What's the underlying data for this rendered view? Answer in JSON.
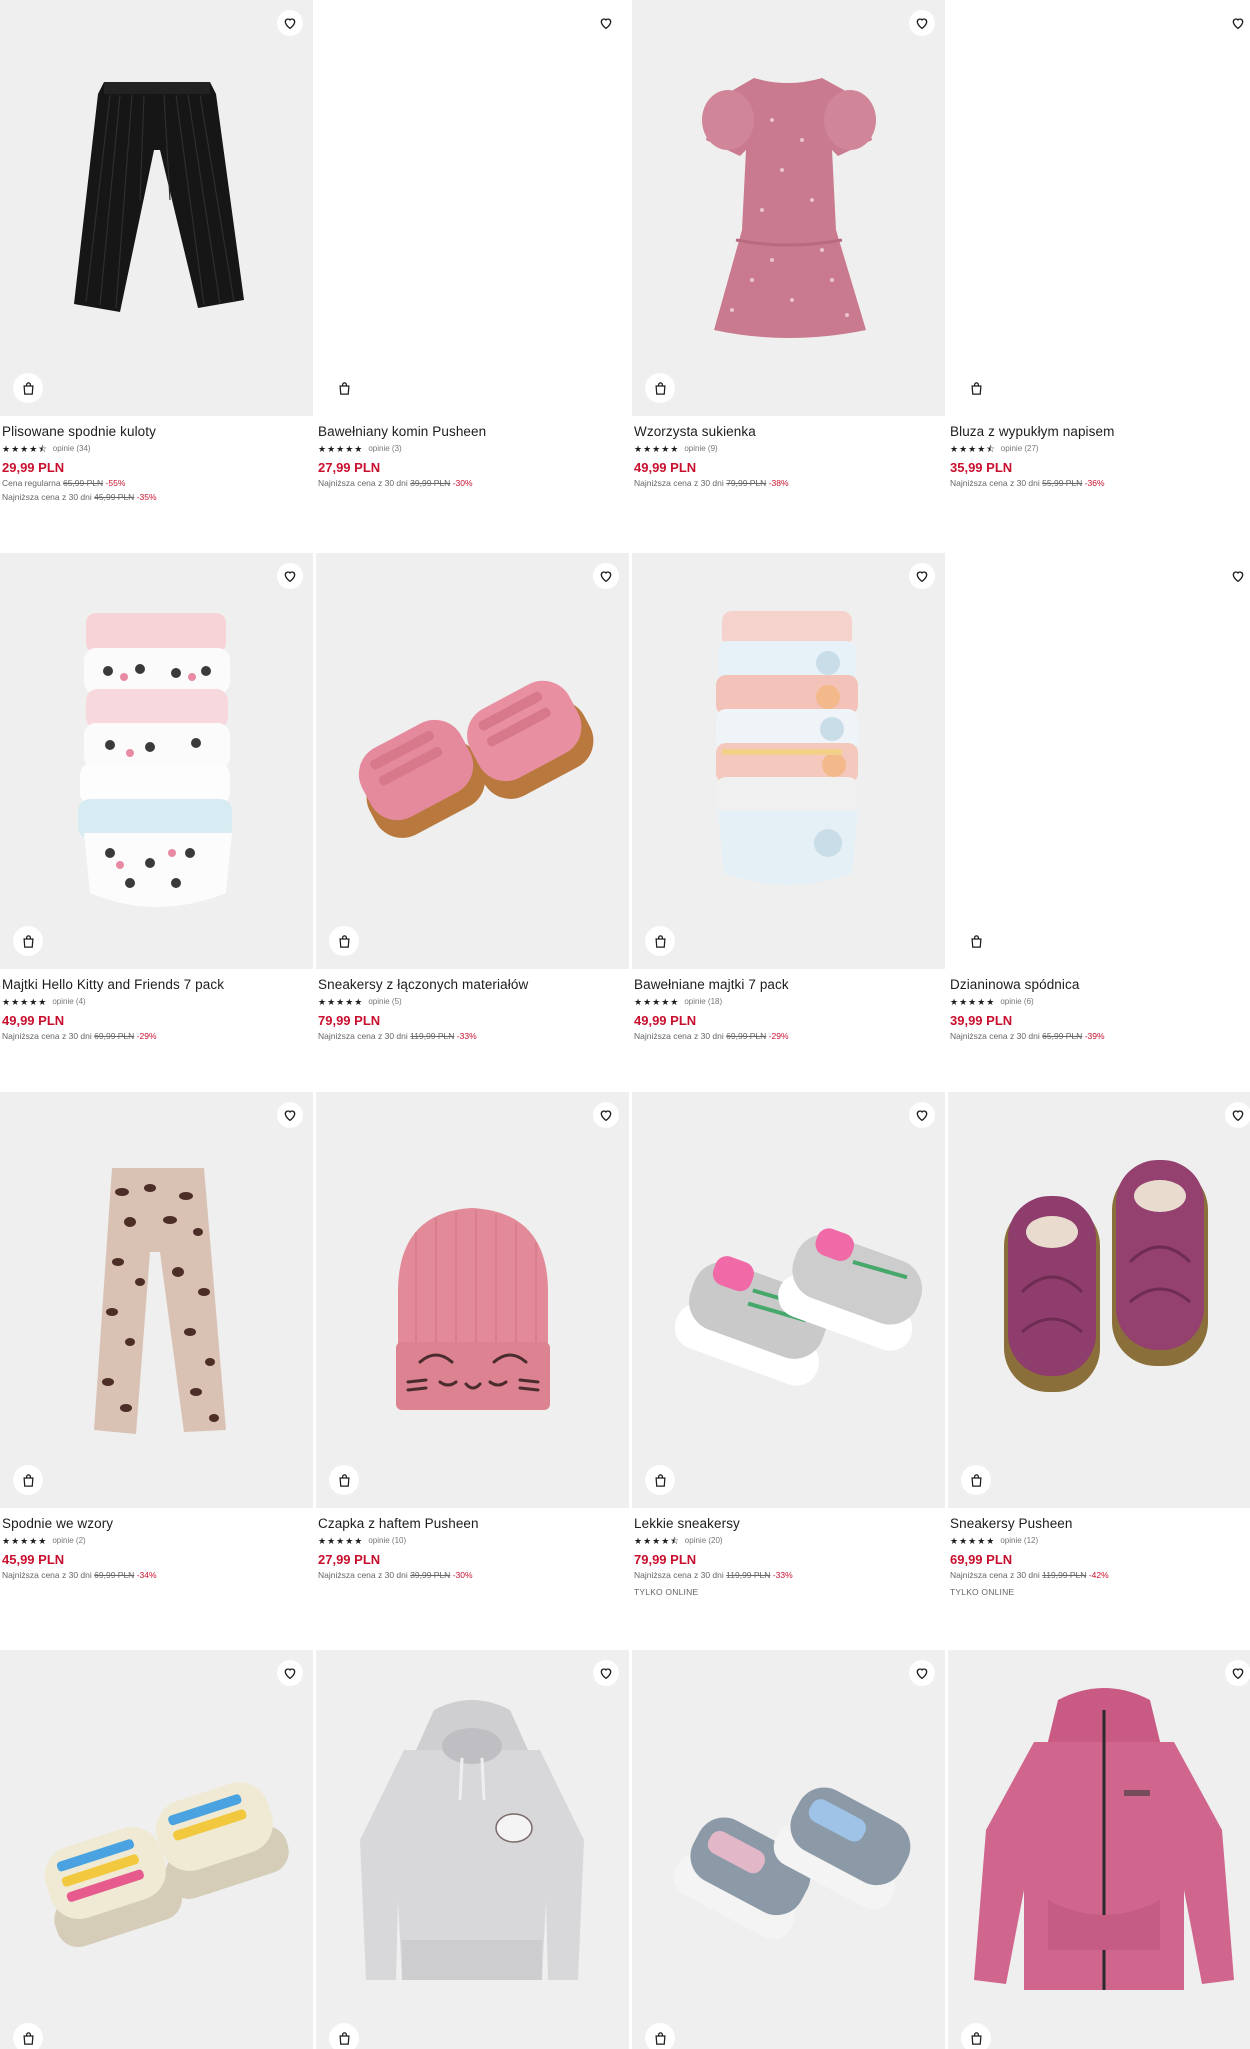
{
  "labels": {
    "lowest_prefix": "Najniższa cena z 30 dni",
    "regular_prefix": "Cena regularna"
  },
  "products": [
    {
      "name": "Plisowane spodnie kuloty",
      "stars": "★★★★⯪",
      "reviews": "opinie (34)",
      "price": "29,99 PLN",
      "regular": "65,99 PLN",
      "regular_discount": "-55%",
      "lowest": "45,99 PLN",
      "lowest_discount": "-35%",
      "online": ""
    },
    {
      "name": "Bawełniany komin Pusheen",
      "stars": "★★★★★",
      "reviews": "opinie (3)",
      "price": "27,99 PLN",
      "lowest": "39,99 PLN",
      "lowest_discount": "-30%",
      "online": ""
    },
    {
      "name": "Wzorzysta sukienka",
      "stars": "★★★★★",
      "reviews": "opinie (9)",
      "price": "49,99 PLN",
      "lowest": "79,99 PLN",
      "lowest_discount": "-38%",
      "online": ""
    },
    {
      "name": "Bluza z wypukłym napisem",
      "stars": "★★★★⯪",
      "reviews": "opinie (27)",
      "price": "35,99 PLN",
      "lowest": "55,99 PLN",
      "lowest_discount": "-36%",
      "online": ""
    },
    {
      "name": "Majtki Hello Kitty and Friends 7 pack",
      "stars": "★★★★★",
      "reviews": "opinie (4)",
      "price": "49,99 PLN",
      "lowest": "69,99 PLN",
      "lowest_discount": "-29%",
      "online": ""
    },
    {
      "name": "Sneakersy z łączonych materiałów",
      "stars": "★★★★★",
      "reviews": "opinie (5)",
      "price": "79,99 PLN",
      "lowest": "119,99 PLN",
      "lowest_discount": "-33%",
      "online": ""
    },
    {
      "name": "Bawełniane majtki 7 pack",
      "stars": "★★★★★",
      "reviews": "opinie (18)",
      "price": "49,99 PLN",
      "lowest": "69,99 PLN",
      "lowest_discount": "-29%",
      "online": ""
    },
    {
      "name": "Dzianinowa spódnica",
      "stars": "★★★★★",
      "reviews": "opinie (6)",
      "price": "39,99 PLN",
      "lowest": "65,99 PLN",
      "lowest_discount": "-39%",
      "online": ""
    },
    {
      "name": "Spodnie we wzory",
      "stars": "★★★★★",
      "reviews": "opinie (2)",
      "price": "45,99 PLN",
      "lowest": "69,99 PLN",
      "lowest_discount": "-34%",
      "online": ""
    },
    {
      "name": "Czapka z haftem Pusheen",
      "stars": "★★★★★",
      "reviews": "opinie (10)",
      "price": "27,99 PLN",
      "lowest": "39,99 PLN",
      "lowest_discount": "-30%",
      "online": ""
    },
    {
      "name": "Lekkie sneakersy",
      "stars": "★★★★⯪",
      "reviews": "opinie (20)",
      "price": "79,99 PLN",
      "lowest": "119,99 PLN",
      "lowest_discount": "-33%",
      "online": "TYLKO ONLINE"
    },
    {
      "name": "Sneakersy Pusheen",
      "stars": "★★★★★",
      "reviews": "opinie (12)",
      "price": "69,99 PLN",
      "lowest": "119,99 PLN",
      "lowest_discount": "-42%",
      "online": "TYLKO ONLINE"
    },
    {
      "name": "",
      "stars": "",
      "reviews": "",
      "price": "",
      "lowest": "",
      "lowest_discount": "",
      "online": ""
    },
    {
      "name": "",
      "stars": "",
      "reviews": "",
      "price": "",
      "lowest": "",
      "lowest_discount": "",
      "online": ""
    },
    {
      "name": "",
      "stars": "",
      "reviews": "",
      "price": "",
      "lowest": "",
      "lowest_discount": "",
      "online": ""
    },
    {
      "name": "",
      "stars": "",
      "reviews": "",
      "price": "",
      "lowest": "",
      "lowest_discount": "",
      "online": ""
    }
  ],
  "images": [
    "pleated-black-culottes",
    "",
    "pink-floral-dress",
    "",
    "hello-kitty-briefs-stack",
    "pink-velcro-sneakers",
    "cat-briefs-stack",
    "",
    "leopard-print-trousers",
    "pink-pusheen-beanie",
    "grey-pink-sneakers",
    "purple-pusheen-sneakers",
    "cream-colorblock-sneakers",
    "grey-pusheen-hoodie",
    "grey-navy-sneakers",
    "pink-windbreaker-jacket"
  ],
  "icons": {
    "wishlist": "heart-outline-icon",
    "cart": "shopping-bag-icon"
  },
  "colors": {
    "price": "#c8102e",
    "discount": "#c8102e",
    "text": "#1d1d1d",
    "photo_bg": "#efefef"
  }
}
